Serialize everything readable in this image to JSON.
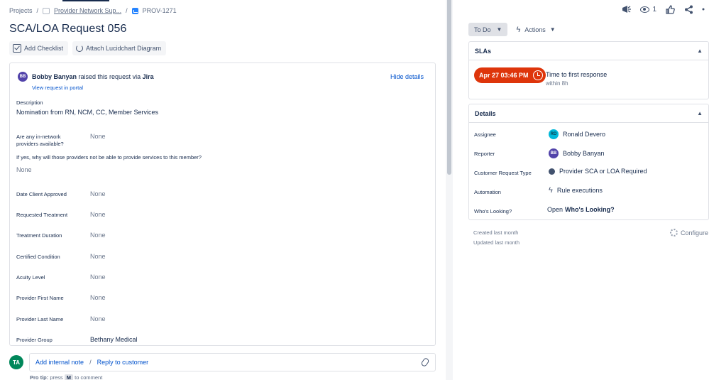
{
  "breadcrumb": {
    "projects": "Projects",
    "project": "Provider Network Sup...",
    "issue_key": "PROV-1271"
  },
  "issue": {
    "title": "SCA/LOA Request 056"
  },
  "toolbar": {
    "add_checklist": "Add Checklist",
    "attach_lucidchart": "Attach Lucidchart Diagram"
  },
  "request": {
    "reporter_initials": "BB",
    "reporter_name": "Bobby Banyan",
    "raised_via_text": "raised this request via",
    "channel": "Jira",
    "view_portal": "View request in portal",
    "hide_details": "Hide details",
    "description_label": "Description",
    "description_text": "Nomination from RN, NCM, CC, Member Services",
    "fields": [
      {
        "label_line1": "Are any in-network",
        "label_line2": "providers available?",
        "value": "None"
      },
      {
        "label": "If yes, why will those providers not be able to provide services to this member?",
        "value": "None"
      },
      {
        "label": "Date Client Approved",
        "value": "None"
      },
      {
        "label": "Requested Treatment",
        "value": "None"
      },
      {
        "label": "Treatment Duration",
        "value": "None"
      },
      {
        "label": "Certified Condition",
        "value": "None"
      },
      {
        "label": "Acuity Level",
        "value": "None"
      },
      {
        "label": "Provider First Name",
        "value": "None"
      },
      {
        "label": "Provider Last Name",
        "value": "None"
      },
      {
        "label": "Provider Group",
        "value": "Bethany Medical"
      }
    ]
  },
  "reply": {
    "user_initials": "TA",
    "add_internal_note": "Add internal note",
    "separator": "/",
    "reply_to_customer": "Reply to customer",
    "pro_tip_prefix": "Pro tip:",
    "pro_tip_press": "press",
    "pro_tip_key": "M",
    "pro_tip_suffix": "to comment"
  },
  "top_icons": {
    "watch_count": "1"
  },
  "status": {
    "current": "To Do",
    "actions": "Actions"
  },
  "slas": {
    "heading": "SLAs",
    "timer": "Apr 27 03:46 PM",
    "label": "Time to first response",
    "sub": "within 8h"
  },
  "details": {
    "heading": "Details",
    "assignee_label": "Assignee",
    "assignee_initials": "RD",
    "assignee": "Ronald Devero",
    "reporter_label": "Reporter",
    "reporter_initials": "BB",
    "reporter": "Bobby Banyan",
    "request_type_label": "Customer Request Type",
    "request_type": "Provider SCA or LOA Required",
    "automation_label": "Automation",
    "automation": "Rule executions",
    "whos_looking_label": "Who's Looking?",
    "whos_looking_open": "Open",
    "whos_looking_link": "Who's Looking?"
  },
  "meta": {
    "created": "Created last month",
    "updated": "Updated last month",
    "configure": "Configure"
  },
  "colors": {
    "sla_breach": "#de350b",
    "link": "#0052cc",
    "avatar_purple": "#5243aa",
    "avatar_teal": "#00b8d9",
    "avatar_green": "#00875a"
  }
}
